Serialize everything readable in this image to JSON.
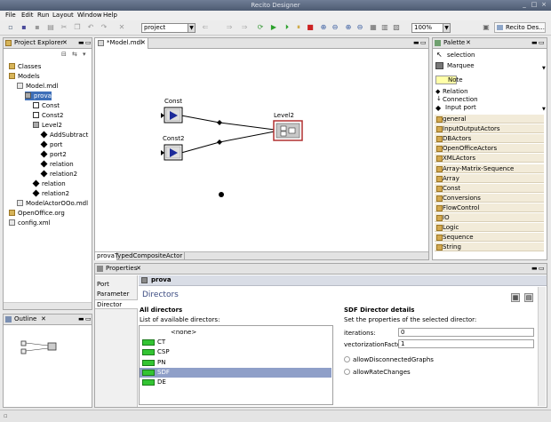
{
  "window": {
    "title": "Recito Designer",
    "min": "_",
    "max": "□",
    "close": "×"
  },
  "menu": [
    "File",
    "Edit",
    "Run",
    "Layout",
    "Window",
    "Help"
  ],
  "toolbar": {
    "project_combo": "project",
    "zoom_combo": "100%",
    "perspective_label": "Recito Des..."
  },
  "project_explorer": {
    "title": "Project Explorer",
    "items": [
      {
        "label": "Classes",
        "depth": 0
      },
      {
        "label": "Models",
        "depth": 0
      },
      {
        "label": "Model.mdl",
        "depth": 1
      },
      {
        "label": "prova",
        "depth": 2
      },
      {
        "label": "Const",
        "depth": 3
      },
      {
        "label": "Const2",
        "depth": 3
      },
      {
        "label": "Level2",
        "depth": 3
      },
      {
        "label": "AddSubtract",
        "depth": 4
      },
      {
        "label": "port",
        "depth": 4
      },
      {
        "label": "port2",
        "depth": 4
      },
      {
        "label": "relation",
        "depth": 4
      },
      {
        "label": "relation2",
        "depth": 4
      },
      {
        "label": "relation",
        "depth": 3
      },
      {
        "label": "relation2",
        "depth": 3
      },
      {
        "label": "ModelActorOOo.mdl",
        "depth": 1
      },
      {
        "label": "OpenOffice.org",
        "depth": 0
      },
      {
        "label": "config.xml",
        "depth": 0
      }
    ]
  },
  "editor": {
    "tab": "*Model.mdl",
    "actor_labels": [
      "Const",
      "Const2",
      "Level2"
    ],
    "bottom_tabs": [
      "prova",
      "TypedCompositeActor"
    ]
  },
  "palette": {
    "title": "Palette",
    "tools": [
      "selection",
      "Marquee",
      "Note",
      "Relation",
      "Connection",
      "Input port"
    ],
    "categories": [
      "general",
      "InputOutputActors",
      "DBActors",
      "OpenOfficeActors",
      "XMLActors",
      "Array-Matrix-Sequence",
      "Array",
      "Const",
      "Conversions",
      "FlowControl",
      "IO",
      "Logic",
      "Sequence",
      "String"
    ]
  },
  "outline": {
    "title": "Outline"
  },
  "properties": {
    "title": "Properties",
    "tabs": [
      "Port",
      "Parameter",
      "Director"
    ],
    "element": "prova",
    "header": "Directors",
    "all_directors": "All directors",
    "list_caption": "List of available directors:",
    "directors": [
      "<none>",
      "CT",
      "CSP",
      "PN",
      "SDF",
      "DE"
    ],
    "details_title": "SDF Director details",
    "details_caption": "Set the properties of the selected director:",
    "iterations_label": "iterations:",
    "iterations_value": "0",
    "vf_label": "vectorizationFactor:",
    "vf_value": "1",
    "chk1": "allowDisconnectedGraphs",
    "chk2": "allowRateChanges"
  },
  "colors": {
    "selection": "#3e6fb8",
    "director_green": "#33c433",
    "palette_item": "#f2ebd9"
  }
}
